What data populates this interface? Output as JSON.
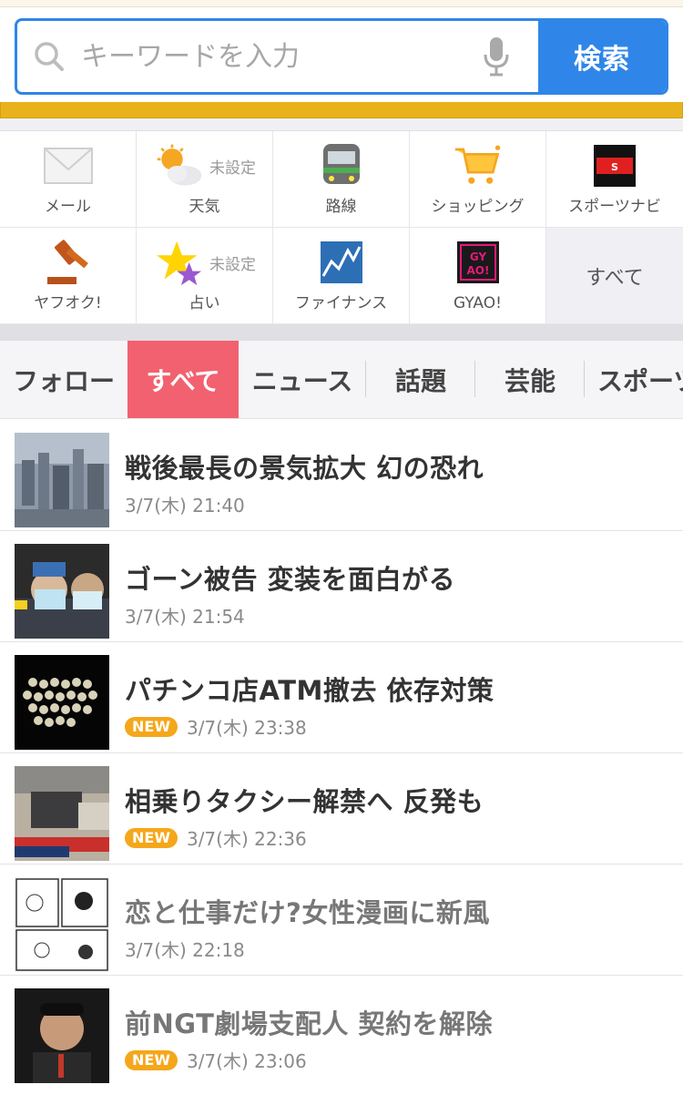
{
  "search": {
    "placeholder": "キーワードを入力",
    "button_label": "検索"
  },
  "services": [
    {
      "label": "メール",
      "icon": "mail-icon"
    },
    {
      "label": "天気",
      "note": "未設定",
      "icon": "weather-icon"
    },
    {
      "label": "路線",
      "icon": "train-icon"
    },
    {
      "label": "ショッピング",
      "icon": "shopping-cart-icon"
    },
    {
      "label": "スポーツナビ",
      "icon": "sportsnavi-icon"
    },
    {
      "label": "ヤフオク!",
      "icon": "auction-gavel-icon"
    },
    {
      "label": "占い",
      "note": "未設定",
      "icon": "fortune-star-icon"
    },
    {
      "label": "ファイナンス",
      "icon": "finance-chart-icon"
    },
    {
      "label": "GYAO!",
      "icon": "gyao-icon"
    },
    {
      "label": "すべて"
    }
  ],
  "tabs": [
    {
      "label": "フォロー"
    },
    {
      "label": "すべて",
      "active": true
    },
    {
      "label": "ニュース"
    },
    {
      "label": "話題"
    },
    {
      "label": "芸能"
    },
    {
      "label": "スポーツ"
    }
  ],
  "news": [
    {
      "headline": "戦後最長の景気拡大 幻の恐れ",
      "time": "3/7(木) 21:40",
      "new": false,
      "read": false
    },
    {
      "headline": "ゴーン被告 変装を面白がる",
      "time": "3/7(木) 21:54",
      "new": false,
      "read": false
    },
    {
      "headline": "パチンコ店ATM撤去 依存対策",
      "time": "3/7(木) 23:38",
      "new": true,
      "badge": "NEW",
      "read": false
    },
    {
      "headline": "相乗りタクシー解禁へ 反発も",
      "time": "3/7(木) 22:36",
      "new": true,
      "badge": "NEW",
      "read": false
    },
    {
      "headline": "恋と仕事だけ?女性漫画に新風",
      "time": "3/7(木) 22:18",
      "new": false,
      "read": true
    },
    {
      "headline": "前NGT劇場支配人 契約を解除",
      "time": "3/7(木) 23:06",
      "new": true,
      "badge": "NEW",
      "read": true
    }
  ],
  "colors": {
    "accent_blue": "#2f86e8",
    "tab_active": "#f26170",
    "new_badge": "#f5a71b"
  }
}
